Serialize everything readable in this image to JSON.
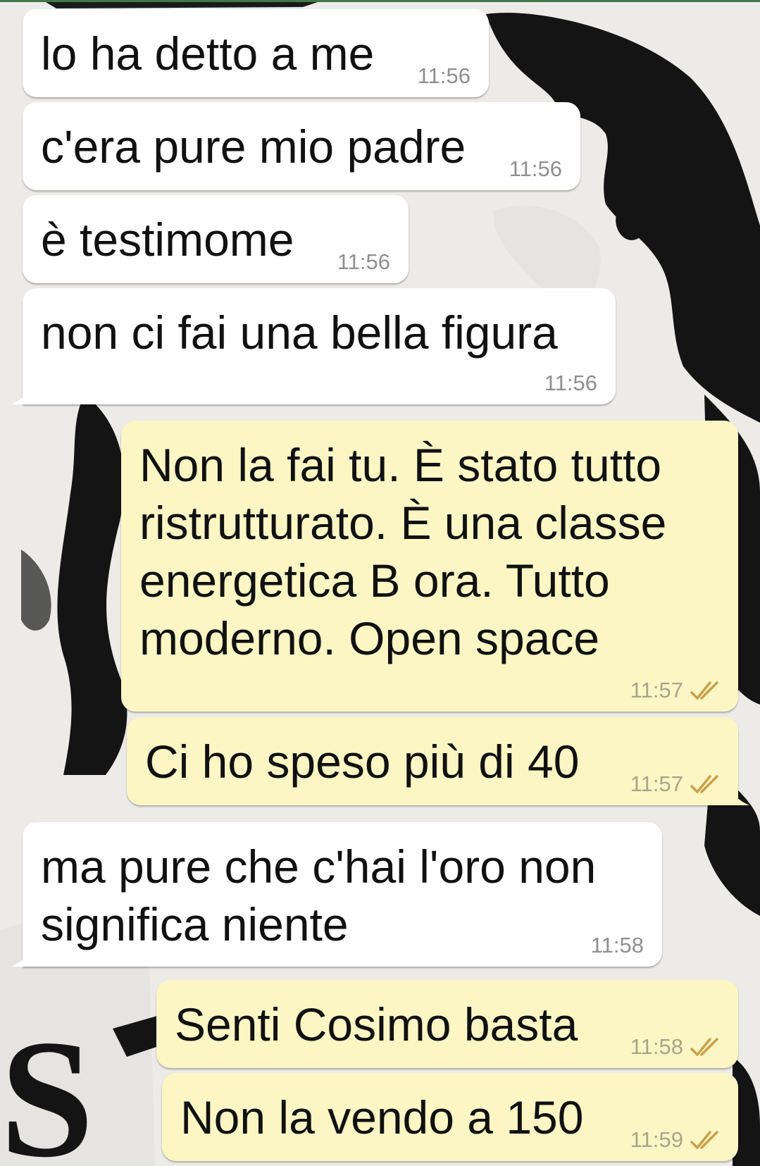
{
  "wallpaper": {
    "description_icon": "portrait-wallpaper-icon",
    "letters": "S"
  },
  "colors": {
    "incoming_bubble": "#ffffff",
    "outgoing_bubble": "#fcf6c4",
    "tick_color": "#c8a04a",
    "time_color": "#8f8f8f"
  },
  "messages": [
    {
      "direction": "in",
      "text": "lo ha detto a me",
      "time": "11:56"
    },
    {
      "direction": "in",
      "text": "c'era pure mio padre",
      "time": "11:56"
    },
    {
      "direction": "in",
      "text": "è testimome",
      "time": "11:56"
    },
    {
      "direction": "in",
      "text": "non ci fai una bella figura",
      "time": "11:56"
    },
    {
      "direction": "out",
      "text": "Non la fai tu. È stato tutto\nristrutturato. È una classe\nenergetica B ora. Tutto\nmoderno. Open space",
      "time": "11:57",
      "status": "read-ticks-icon"
    },
    {
      "direction": "out",
      "text": "Ci ho speso più di 40",
      "time": "11:57",
      "status": "read-ticks-icon"
    },
    {
      "direction": "in",
      "text": "ma pure che c'hai l'oro non\nsignifica niente",
      "time": "11:58"
    },
    {
      "direction": "out",
      "text": "Senti Cosimo basta",
      "time": "11:58",
      "status": "read-ticks-icon"
    },
    {
      "direction": "out",
      "text": "Non la vendo a 150",
      "time": "11:59",
      "status": "read-ticks-icon"
    }
  ]
}
